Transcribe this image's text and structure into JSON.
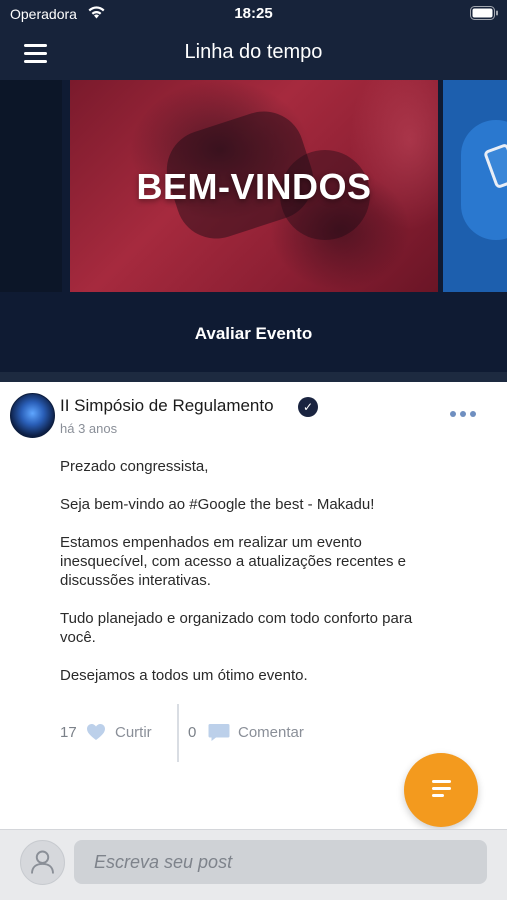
{
  "status_bar": {
    "carrier": "Operadora",
    "time": "18:25",
    "wifi_icon": "wifi-icon",
    "battery_icon": "battery-icon"
  },
  "nav": {
    "title": "Linha do tempo",
    "menu_icon": "hamburger-menu-icon"
  },
  "banner": {
    "headline": "BEM-VINDOS",
    "action_label": "Avaliar Evento"
  },
  "post": {
    "author": "II Simpósio de Regulamento",
    "verified_icon": "verified-badge-icon",
    "timestamp": "há 3 anos",
    "paragraphs": [
      "Prezado congressista,",
      "Seja bem-vindo ao #Google the best - Makadu!",
      "Estamos empenhados em realizar um evento\ninesquecível, com acesso a atualizações recentes e\ndiscussões interativas.",
      "Tudo planejado e organizado com todo conforto para\nvocê.",
      "Desejamos a todos um ótimo evento."
    ],
    "likes": {
      "count": "17",
      "label": "Curtir",
      "icon": "heart-icon"
    },
    "comments": {
      "count": "0",
      "label": "Comentar",
      "icon": "comment-icon"
    }
  },
  "fab": {
    "icon": "text-lines-icon"
  },
  "composer": {
    "placeholder": "Escreva seu post",
    "avatar_icon": "user-icon"
  },
  "colors": {
    "header": "#17233a",
    "fab": "#f39a1e",
    "accent": "#6f8fc0"
  }
}
